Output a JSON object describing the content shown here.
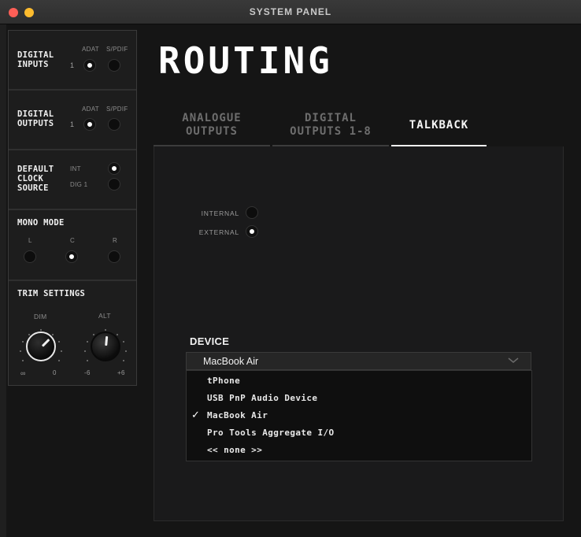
{
  "window": {
    "title": "SYSTEM PANEL"
  },
  "sidebar": {
    "digital_inputs": {
      "label": "DIGITAL\nINPUTS",
      "col1": "ADAT",
      "col2": "S/PDIF",
      "row": "1",
      "selected": "ADAT"
    },
    "digital_outputs": {
      "label": "DIGITAL\nOUTPUTS",
      "col1": "ADAT",
      "col2": "S/PDIF",
      "row": "1",
      "selected": "ADAT"
    },
    "clock_source": {
      "label": "DEFAULT\nCLOCK\nSOURCE",
      "opt1": "INT",
      "opt2": "DIG 1",
      "selected": "INT"
    },
    "mono_mode": {
      "label": "MONO MODE",
      "l": "L",
      "c": "C",
      "r": "R",
      "selected": "C"
    },
    "trim": {
      "label": "TRIM SETTINGS",
      "dim": {
        "label": "DIM",
        "min": "∞",
        "max": "0"
      },
      "alt": {
        "label": "ALT",
        "min": "-6",
        "max": "+6"
      }
    }
  },
  "main": {
    "heading": "ROUTING",
    "tabs": [
      {
        "label": "ANALOGUE\nOUTPUTS",
        "active": false
      },
      {
        "label": "DIGITAL\nOUTPUTS 1-8",
        "active": false
      },
      {
        "label": "TALKBACK",
        "active": true
      }
    ],
    "talkback": {
      "internal_label": "INTERNAL",
      "external_label": "EXTERNAL",
      "selected": "EXTERNAL",
      "device_label": "DEVICE",
      "device_value": "MacBook Air",
      "device_options": [
        "tPhone",
        "USB PnP Audio Device",
        "MacBook Air",
        "Pro Tools Aggregate I/O",
        "<< none >>"
      ],
      "checked_option": "MacBook Air"
    }
  }
}
